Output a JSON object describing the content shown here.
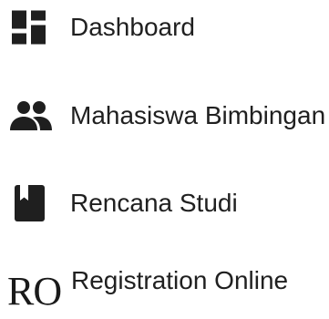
{
  "menu": {
    "items": [
      {
        "label": "Dashboard",
        "icon": "dashboard-icon"
      },
      {
        "label": "Mahasiswa Bimbingan",
        "icon": "people-icon"
      },
      {
        "label": "Rencana Studi",
        "icon": "book-icon"
      },
      {
        "label": "Registration Online",
        "icon": "ro-icon",
        "icon_text": "RO"
      }
    ]
  },
  "colors": {
    "icon": "#1f1f1f",
    "text": "#202020",
    "background": "#ffffff"
  }
}
